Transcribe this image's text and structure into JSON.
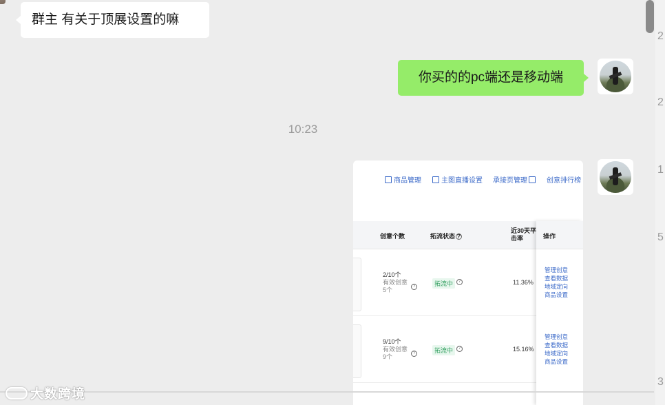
{
  "messages": {
    "incoming_text": "群主 有关于顶展设置的嘛",
    "outgoing_text": "你买的的pc端还是移动端",
    "timestamp": "10:23"
  },
  "screenshot": {
    "nav": [
      {
        "label": "商品管理",
        "icon": "calendar-icon"
      },
      {
        "label": "主图直播设置",
        "icon": "plus-box-icon"
      },
      {
        "label": "承接页管理",
        "icon": "external-link-icon"
      },
      {
        "label": "创意排行榜",
        "icon": ""
      }
    ],
    "headers": {
      "creative_count": "创意个数",
      "traffic_status": "拓流状态",
      "ctr_line1": "近30天平",
      "ctr_line2": "击率",
      "actions": "操作"
    },
    "rows": [
      {
        "count": "2/10个",
        "valid_label": "有效创意",
        "valid_count": "5个",
        "status": "拓流中",
        "rate": "11.36%",
        "actions": [
          "管理创意",
          "查看数据",
          "地域定向",
          "商品设置"
        ]
      },
      {
        "count": "9/10个",
        "valid_label": "有效创意",
        "valid_count": "9个",
        "status": "拓流中",
        "rate": "15.16%",
        "actions": [
          "管理创意",
          "查看数据",
          "地域定向",
          "商品设置"
        ]
      }
    ]
  },
  "edge_numbers": [
    "2",
    "2",
    "1",
    "5",
    "3"
  ],
  "watermark": "大数跨境",
  "colors": {
    "outgoing_bubble": "#95ec69",
    "incoming_bubble": "#ffffff",
    "background": "#ededed",
    "link_blue": "#3d6bc9",
    "status_green": "#2f9e5d"
  }
}
